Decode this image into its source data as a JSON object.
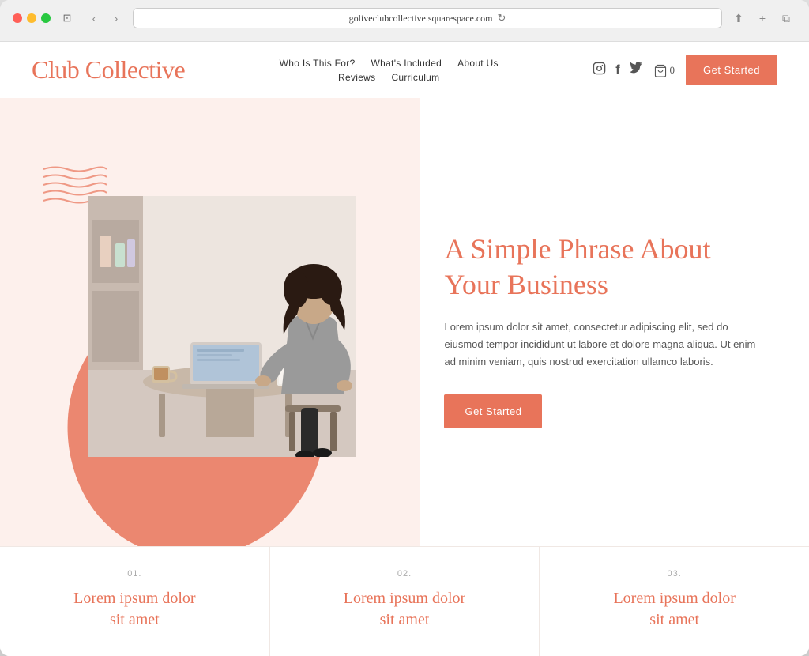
{
  "browser": {
    "url": "goliveclubcollective.squarespace.com",
    "traffic_lights": [
      "red",
      "yellow",
      "green"
    ]
  },
  "header": {
    "logo": "Club Collective",
    "nav": {
      "row1": [
        {
          "label": "Who Is This For?",
          "id": "who-is-this-for"
        },
        {
          "label": "What's Included",
          "id": "whats-included"
        },
        {
          "label": "About Us",
          "id": "about-us"
        }
      ],
      "row2": [
        {
          "label": "Reviews",
          "id": "reviews"
        },
        {
          "label": "Curriculum",
          "id": "curriculum"
        }
      ]
    },
    "cart_count": "0",
    "cta_button": "Get Started",
    "social": [
      {
        "icon": "instagram",
        "symbol": "◎"
      },
      {
        "icon": "facebook",
        "symbol": "f"
      },
      {
        "icon": "twitter",
        "symbol": "𝕥"
      }
    ]
  },
  "hero": {
    "title": "A Simple Phrase About Your Business",
    "description": "Lorem ipsum dolor sit amet, consectetur adipiscing elit, sed do eiusmod tempor incididunt ut labore et dolore magna aliqua. Ut enim ad minim veniam, quis nostrud exercitation ullamco laboris.",
    "cta_button": "Get Started"
  },
  "features": [
    {
      "number": "01.",
      "title": "Lorem ipsum dolor sit amet"
    },
    {
      "number": "02.",
      "title": "Lorem ipsum dolor sit amet"
    },
    {
      "number": "03.",
      "title": "Lorem ipsum dolor sit amet"
    }
  ],
  "colors": {
    "primary": "#e8745a",
    "background_light": "#fdf0ec",
    "text_dark": "#333",
    "text_medium": "#555",
    "text_light": "#aaa"
  }
}
